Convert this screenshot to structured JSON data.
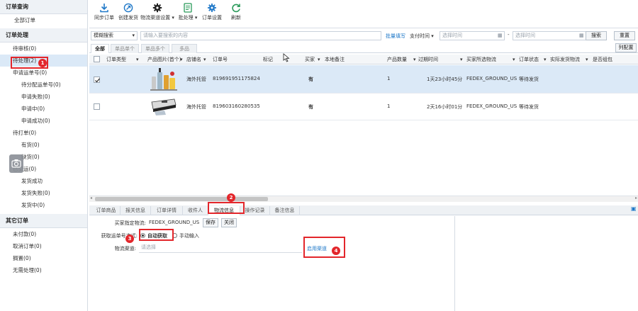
{
  "sidebar": {
    "sections": {
      "order_query": {
        "title": "订单查询",
        "items": [
          "全部订单"
        ]
      },
      "order_process": {
        "title": "订单处理",
        "items": [
          "待审核(0)",
          "待处理(2)",
          "申请运单号(0)",
          "待分配运单号(0)",
          "申请失败(0)",
          "申请中(0)",
          "申请成功(0)",
          "待打单(0)",
          "有货(0)",
          "缺货(0)",
          "已交运(0)",
          "发货成功",
          "发货失败(0)",
          "发货中(0)"
        ]
      },
      "other_orders": {
        "title": "其它订单",
        "items": [
          "未付款(0)",
          "取消订单(0)",
          "搁置(0)",
          "无需处理(0)"
        ]
      }
    }
  },
  "badges": [
    "1",
    "2",
    "3",
    "4"
  ],
  "toolbar": {
    "buttons": [
      "同步订单",
      "创建发货",
      "物流渠道设置",
      "批处理",
      "订单设置",
      "刷新"
    ]
  },
  "filter": {
    "search_type": "模糊搜索",
    "search_placeholder": "请输入要搜索的内容",
    "batch_fill": "批量填写",
    "time_type": "支付时间",
    "time_start_placeholder": "选择时间",
    "range_sep": "-",
    "time_end_placeholder": "选择时间",
    "search_button": "搜索",
    "reset_button": "重置"
  },
  "tabs": [
    "全部",
    "单品单个",
    "单品多个",
    "多品"
  ],
  "column_config": "列配置",
  "table": {
    "headers": [
      "订单类型",
      "产品图片(首个)",
      "店铺名",
      "订单号",
      "标记",
      "买家",
      "本地备注",
      "产品数量",
      "过期时间",
      "买家所选物流",
      "订单状态",
      "实际发货物流",
      "是否组包"
    ],
    "rows": [
      {
        "store": "海外托管",
        "order_no": "819691951175824",
        "buyer": "有",
        "qty": "1",
        "expire": "1天23小时45分",
        "logistics": "FEDEX_GROUND_US",
        "status": "等待发货",
        "checked": true
      },
      {
        "store": "海外托管",
        "order_no": "819603160280535",
        "buyer": "有",
        "qty": "1",
        "expire": "2天16小时01分",
        "logistics": "FEDEX_GROUND_US",
        "status": "等待发货",
        "checked": false
      }
    ]
  },
  "bottom_tabs": [
    "订单商品",
    "报关信息",
    "订单详情",
    "收件人",
    "物流信息",
    "操作记录",
    "备注信息"
  ],
  "logistics_info": {
    "buyer_logistics_label": "买家指定物流:",
    "buyer_logistics_value": "FEDEX_GROUND_US",
    "save_button": "保存",
    "close_button": "关闭",
    "tracking_method_label": "获取运单号方式:",
    "auto_option": "自动获取",
    "manual_option": "手动输入",
    "channel_label": "物流渠道:",
    "channel_placeholder": "请选择",
    "enable_channel": "启用渠道"
  },
  "colors": {
    "accent": "#1f78c8",
    "highlight": "#e3262b",
    "selected_row": "#dbe9f7",
    "section_bg": "#eef2f6"
  }
}
